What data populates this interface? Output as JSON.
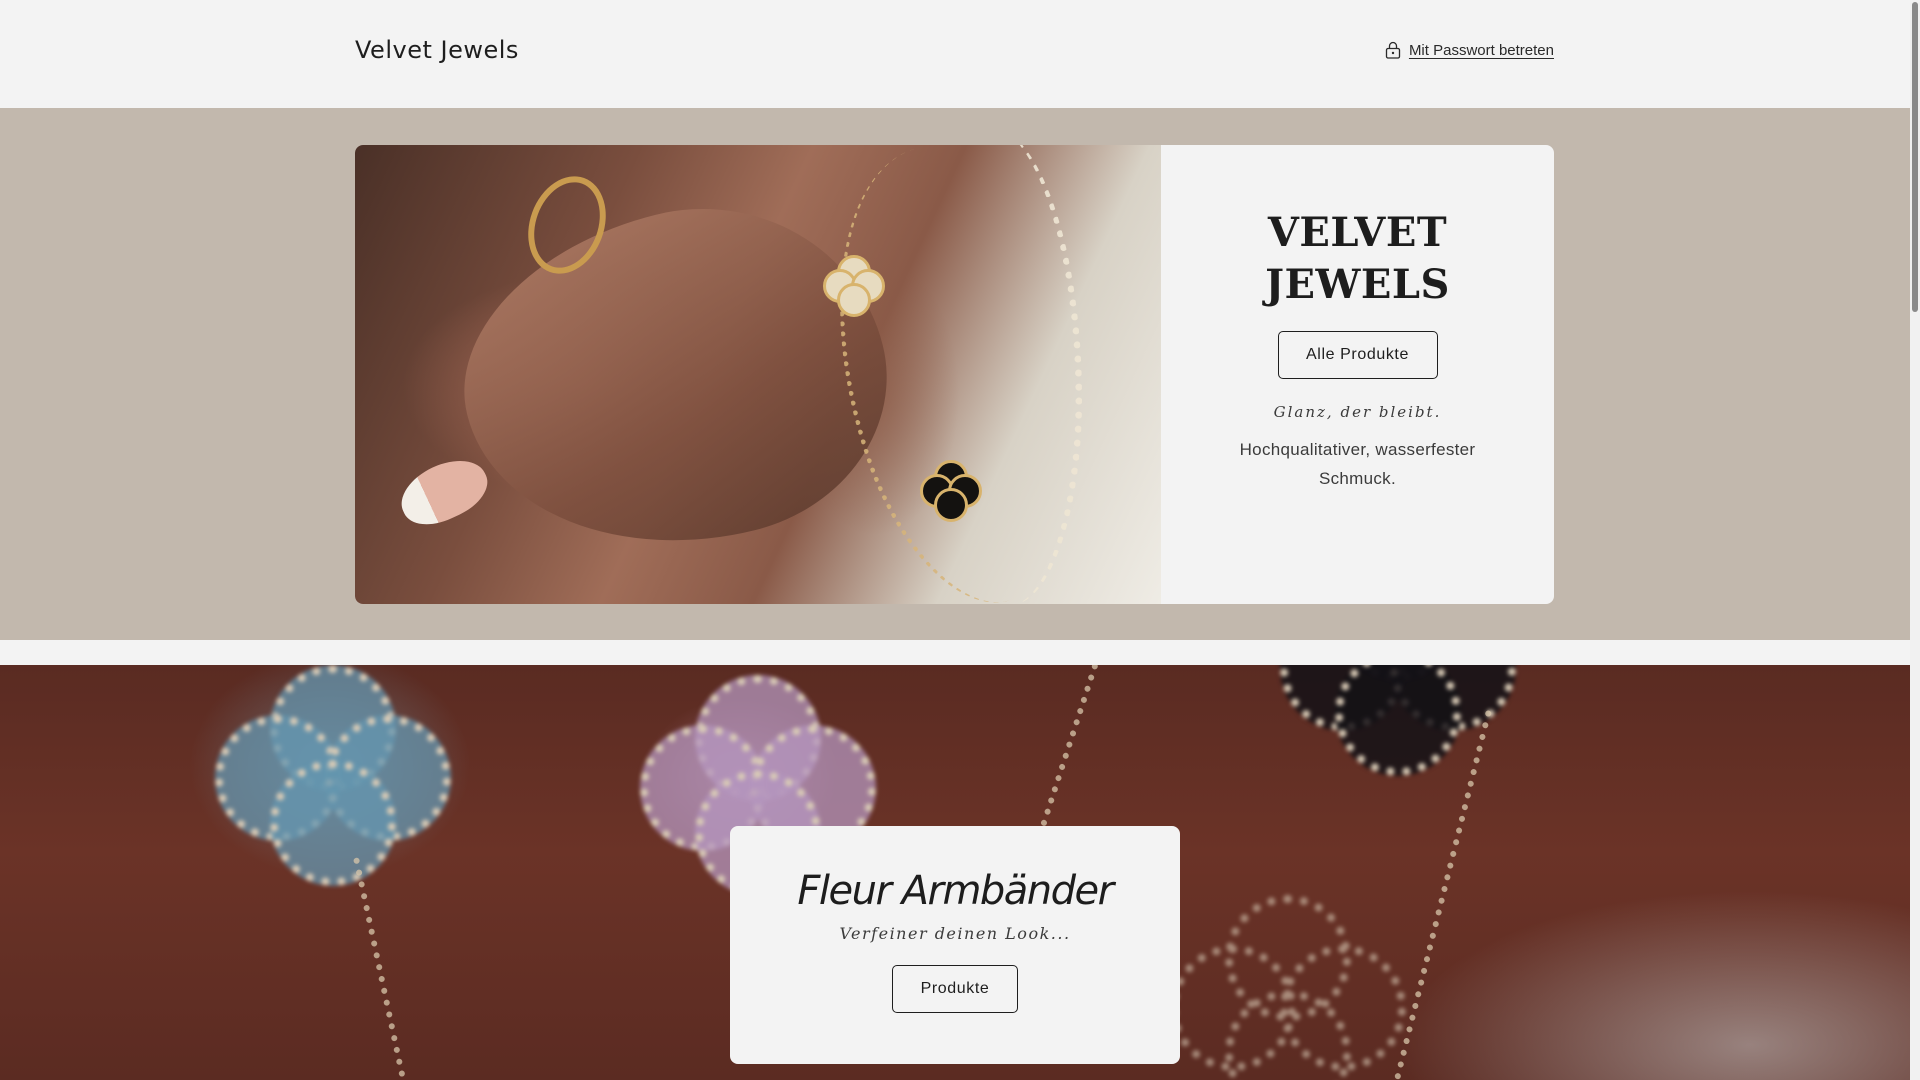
{
  "header": {
    "brand": "Velvet Jewels",
    "password_link": "Mit Passwort betreten",
    "password_icon": "lock-icon"
  },
  "hero": {
    "title": "VELVET JEWELS",
    "button": "Alle Produkte",
    "tagline": "Glanz, der bleibt.",
    "description": "Hochqualitativer, wasserfester Schmuck."
  },
  "collection": {
    "title": "Fleur Armbänder",
    "subtitle": "Verfeiner deinen Look...",
    "button": "Produkte"
  },
  "colors": {
    "header_bg": "#f3f3f3",
    "band_bg": "#c2b8ad",
    "text": "#1c1c1c"
  }
}
